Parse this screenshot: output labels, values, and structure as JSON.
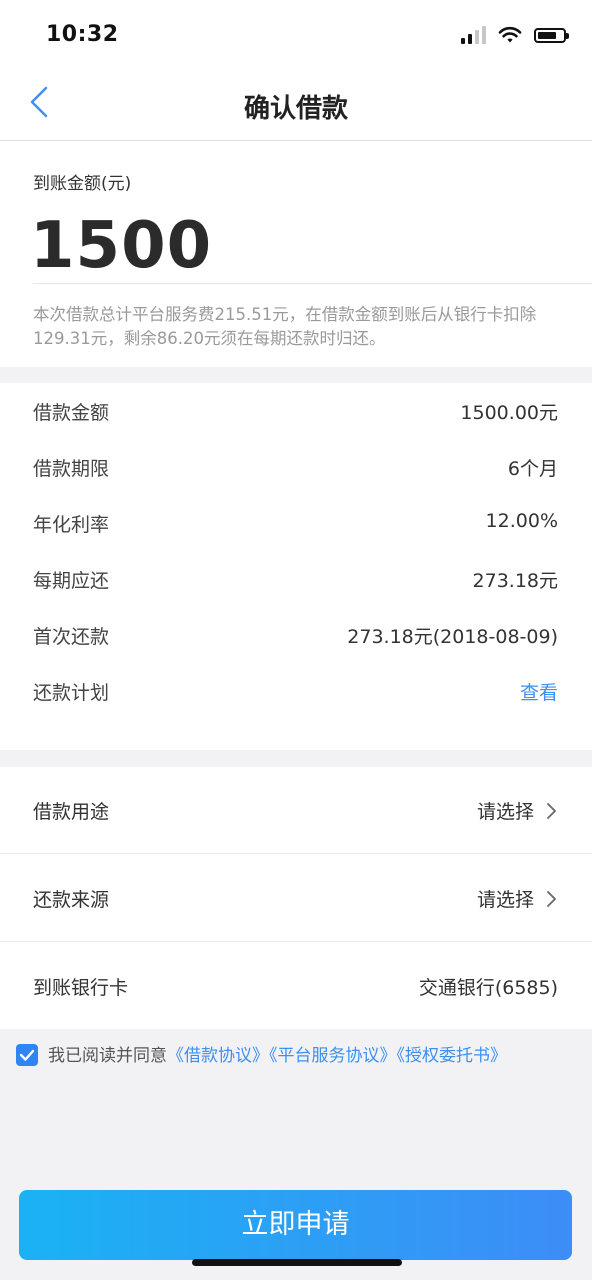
{
  "status_bar": {
    "time": "10:32"
  },
  "nav": {
    "title": "确认借款"
  },
  "amount": {
    "label": "到账金额(元)",
    "value": "1500",
    "fee_note": "本次借款总计平台服务费215.51元，在借款金额到账后从银行卡扣除129.31元，剩余86.20元须在每期还款时归还。"
  },
  "details": [
    {
      "label": "借款金额",
      "value": "1500.00元"
    },
    {
      "label": "借款期限",
      "value": "6个月"
    },
    {
      "label": "年化利率",
      "value": "12.00%"
    },
    {
      "label": "每期应还",
      "value": "273.18元"
    },
    {
      "label": "首次还款",
      "value": "273.18元(2018-08-09)"
    },
    {
      "label": "还款计划",
      "value": "查看"
    }
  ],
  "selects": {
    "purpose": {
      "label": "借款用途",
      "value": "请选择"
    },
    "source": {
      "label": "还款来源",
      "value": "请选择"
    },
    "bank_card": {
      "label": "到账银行卡",
      "value": "交通银行(6585)"
    }
  },
  "agreement": {
    "prefix": "我已阅读并同意",
    "link_loan": "《借款协议》",
    "link_platform": "《平台服务协议》",
    "link_authorization": "《授权委托书》",
    "checked": true
  },
  "apply_button": {
    "label": "立即申请"
  },
  "colors": {
    "accent": "#3d8ff0",
    "button_start": "#1ab2f4",
    "button_end": "#3d8df6"
  }
}
